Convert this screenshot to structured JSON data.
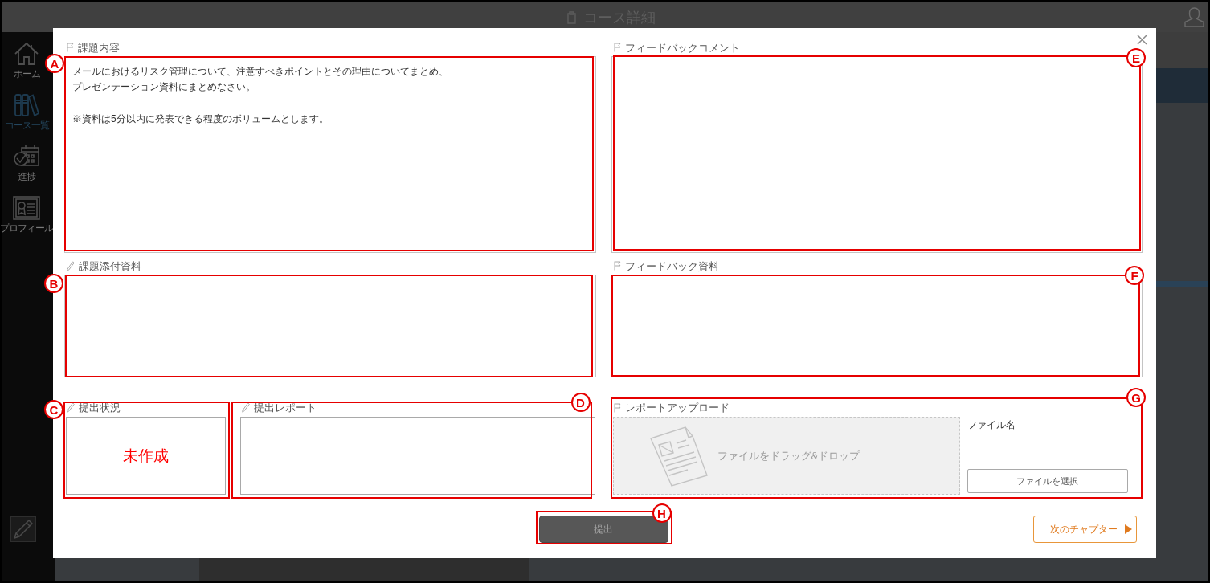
{
  "header": {
    "title": "コース詳細"
  },
  "sidebar": {
    "items": [
      {
        "label": "ホーム",
        "selected": false
      },
      {
        "label": "コース一覧",
        "selected": true
      },
      {
        "label": "進捗",
        "selected": false
      },
      {
        "label": "プロフィール",
        "selected": false
      }
    ]
  },
  "dialog": {
    "rows": [
      {
        "cells": [
          {
            "kind": "text",
            "label": "課題内容",
            "editable": false,
            "callout": "A",
            "paragraphs": [
              [
                "メールにおけるリスク管理について、注意すべきポイントとその理由についてまとめ、",
                "プレゼンテーション資料にまとめなさい。"
              ],
              [
                "※資料は5分以内に発表できる程度のボリュームとします。"
              ]
            ]
          },
          {
            "kind": "text",
            "label": "フィードバックコメント",
            "editable": false,
            "callout": "E"
          }
        ]
      },
      {
        "cells": [
          {
            "kind": "files",
            "label": "課題添付資料",
            "editable": true,
            "callout": "B"
          },
          {
            "kind": "files",
            "label": "フィードバック資料",
            "editable": false,
            "callout": "F"
          }
        ]
      },
      {
        "cells": [
          {
            "kind": "status",
            "label": "提出状況",
            "editable": true,
            "callout": "C",
            "value": "未作成"
          },
          {
            "kind": "report",
            "label": "提出レポート",
            "editable": true,
            "callout": "D"
          },
          {
            "kind": "upload",
            "label": "レポートアップロード",
            "editable": false,
            "callout": "G",
            "drop_text": "ファイルをドラッグ&ドロップ",
            "file_name_label": "ファイル名",
            "select_button": "ファイルを選択"
          }
        ]
      }
    ],
    "submit_button": {
      "label": "提出",
      "disabled": true,
      "callout": "H"
    },
    "next_button": {
      "label": "次のチャプター"
    }
  }
}
